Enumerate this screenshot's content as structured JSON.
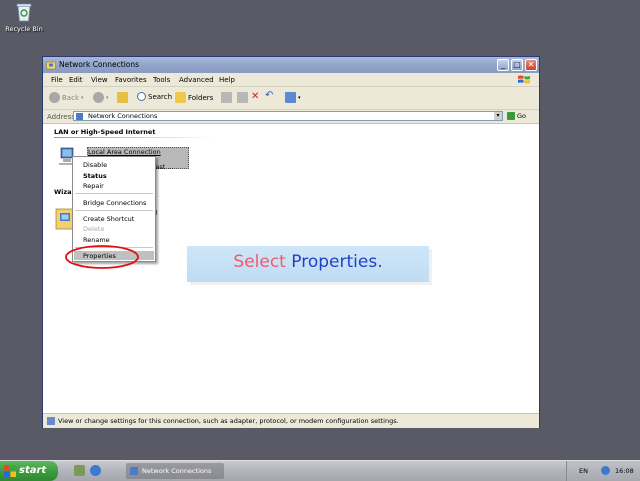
{
  "desktop": {
    "recycle_bin_label": "Recycle Bin"
  },
  "window": {
    "title": "Network Connections",
    "menu": [
      "File",
      "Edit",
      "View",
      "Favorites",
      "Tools",
      "Advanced",
      "Help"
    ],
    "toolbar": {
      "back": "Back",
      "search": "Search",
      "folders": "Folders"
    },
    "address": {
      "label": "Address",
      "value": "Network Connections",
      "go": "Go"
    },
    "content": {
      "section_lan": "LAN or High-Speed Internet",
      "lan_connection_name": "Local Area Connection",
      "lan_connection_sub": "d Fast ...",
      "section_wizard": "Wiza",
      "wizard_item_partial": "d"
    },
    "status_text": "View or change settings for this connection, such as adapter, protocol, or modem configuration settings."
  },
  "context_menu": {
    "items": [
      {
        "label": "Disable",
        "enabled": true,
        "bold": false
      },
      {
        "label": "Status",
        "enabled": true,
        "bold": true
      },
      {
        "label": "Repair",
        "enabled": true,
        "bold": false
      },
      {
        "label": "Bridge Connections",
        "enabled": true,
        "bold": false
      },
      {
        "label": "Create Shortcut",
        "enabled": true,
        "bold": false
      },
      {
        "label": "Delete",
        "enabled": false,
        "bold": false
      },
      {
        "label": "Rename",
        "enabled": true,
        "bold": false
      },
      {
        "label": "Properties",
        "enabled": true,
        "bold": false,
        "highlighted": true
      }
    ]
  },
  "caption": {
    "part1": "Select ",
    "part2": "Properties",
    "part3": "."
  },
  "taskbar": {
    "start_label": "start",
    "task_item": "Network Connections",
    "language": "EN",
    "clock": "16:08"
  },
  "colors": {
    "highlight_ellipse": "#e01010",
    "caption_bg": "#c8e2f6",
    "caption_red": "#f05a6a",
    "caption_blue": "#2040c8",
    "start_green": "#3d9a3d"
  }
}
